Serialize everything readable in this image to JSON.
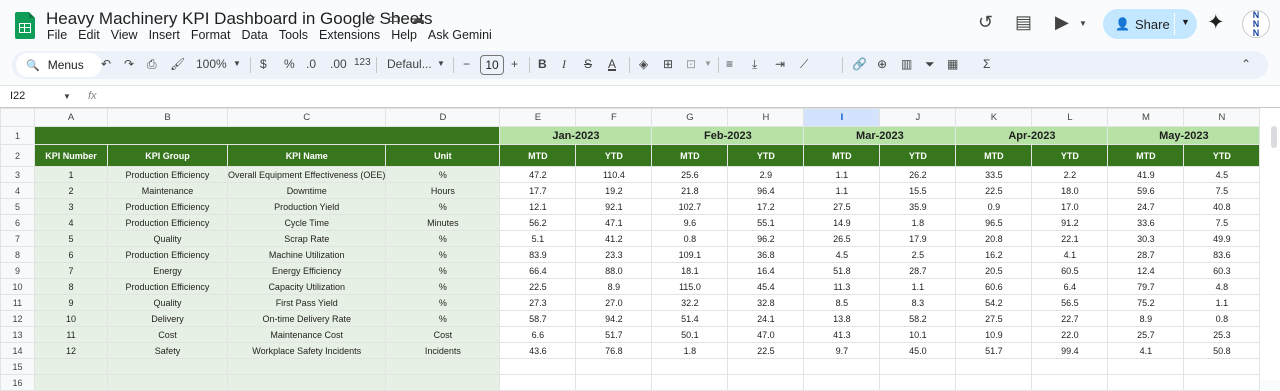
{
  "app": {
    "title": "Heavy Machinery KPI Dashboard in Google Sheets"
  },
  "menu": [
    "File",
    "Edit",
    "View",
    "Insert",
    "Format",
    "Data",
    "Tools",
    "Extensions",
    "Help",
    "Ask Gemini"
  ],
  "share": {
    "label": "Share"
  },
  "avatar": {
    "line1": "N",
    "line2": "N",
    "line3": "N"
  },
  "toolbar": {
    "menus_label": "Menus",
    "zoom": "100%",
    "currency": "$",
    "percent": "%",
    "dec_dec": ".0",
    "inc_dec": ".00",
    "number_format": "123",
    "font": "Defaul...",
    "font_size": "10"
  },
  "formula": {
    "name_box": "I22",
    "fx": "fx"
  },
  "columns": [
    "A",
    "B",
    "C",
    "D",
    "E",
    "F",
    "G",
    "H",
    "I",
    "J",
    "K",
    "L",
    "M",
    "N"
  ],
  "months": [
    "Jan-2023",
    "Feb-2023",
    "Mar-2023",
    "Apr-2023",
    "May-2023"
  ],
  "headers": {
    "kpi_number": "KPI Number",
    "kpi_group": "KPI Group",
    "kpi_name": "KPI Name",
    "unit": "Unit",
    "mtd": "MTD",
    "ytd": "YTD"
  },
  "rows": [
    {
      "num": "1",
      "group": "Production Efficiency",
      "name": "Overall Equipment Effectiveness (OEE)",
      "unit": "%",
      "vals": [
        "47.2",
        "110.4",
        "25.6",
        "2.9",
        "1.1",
        "26.2",
        "33.5",
        "2.2",
        "41.9",
        "4.5"
      ]
    },
    {
      "num": "2",
      "group": "Maintenance",
      "name": "Downtime",
      "unit": "Hours",
      "vals": [
        "17.7",
        "19.2",
        "21.8",
        "96.4",
        "1.1",
        "15.5",
        "22.5",
        "18.0",
        "59.6",
        "7.5"
      ]
    },
    {
      "num": "3",
      "group": "Production Efficiency",
      "name": "Production Yield",
      "unit": "%",
      "vals": [
        "12.1",
        "92.1",
        "102.7",
        "17.2",
        "27.5",
        "35.9",
        "0.9",
        "17.0",
        "24.7",
        "40.8"
      ]
    },
    {
      "num": "4",
      "group": "Production Efficiency",
      "name": "Cycle Time",
      "unit": "Minutes",
      "vals": [
        "56.2",
        "47.1",
        "9.6",
        "55.1",
        "14.9",
        "1.8",
        "96.5",
        "91.2",
        "33.6",
        "7.5"
      ]
    },
    {
      "num": "5",
      "group": "Quality",
      "name": "Scrap Rate",
      "unit": "%",
      "vals": [
        "5.1",
        "41.2",
        "0.8",
        "96.2",
        "26.5",
        "17.9",
        "20.8",
        "22.1",
        "30.3",
        "49.9"
      ]
    },
    {
      "num": "6",
      "group": "Production Efficiency",
      "name": "Machine Utilization",
      "unit": "%",
      "vals": [
        "83.9",
        "23.3",
        "109.1",
        "36.8",
        "4.5",
        "2.5",
        "16.2",
        "4.1",
        "28.7",
        "83.6"
      ]
    },
    {
      "num": "7",
      "group": "Energy",
      "name": "Energy Efficiency",
      "unit": "%",
      "vals": [
        "66.4",
        "88.0",
        "18.1",
        "16.4",
        "51.8",
        "28.7",
        "20.5",
        "60.5",
        "12.4",
        "60.3"
      ]
    },
    {
      "num": "8",
      "group": "Production Efficiency",
      "name": "Capacity Utilization",
      "unit": "%",
      "vals": [
        "22.5",
        "8.9",
        "115.0",
        "45.4",
        "11.3",
        "1.1",
        "60.6",
        "6.4",
        "79.7",
        "4.8"
      ]
    },
    {
      "num": "9",
      "group": "Quality",
      "name": "First Pass Yield",
      "unit": "%",
      "vals": [
        "27.3",
        "27.0",
        "32.2",
        "32.8",
        "8.5",
        "8.3",
        "54.2",
        "56.5",
        "75.2",
        "1.1"
      ]
    },
    {
      "num": "10",
      "group": "Delivery",
      "name": "On-time Delivery Rate",
      "unit": "%",
      "vals": [
        "58.7",
        "94.2",
        "51.4",
        "24.1",
        "13.8",
        "58.2",
        "27.5",
        "22.7",
        "8.9",
        "0.8"
      ]
    },
    {
      "num": "11",
      "group": "Cost",
      "name": "Maintenance Cost",
      "unit": "Cost",
      "vals": [
        "6.6",
        "51.7",
        "50.1",
        "47.0",
        "41.3",
        "10.1",
        "10.9",
        "22.0",
        "25.7",
        "25.3"
      ]
    },
    {
      "num": "12",
      "group": "Safety",
      "name": "Workplace Safety Incidents",
      "unit": "Incidents",
      "vals": [
        "43.6",
        "76.8",
        "1.8",
        "22.5",
        "9.7",
        "45.0",
        "51.7",
        "99.4",
        "4.1",
        "50.8"
      ]
    }
  ],
  "row_numbers": [
    "1",
    "2",
    "3",
    "4",
    "5",
    "6",
    "7",
    "8",
    "9",
    "10",
    "11",
    "12",
    "13",
    "14",
    "15",
    "16"
  ]
}
